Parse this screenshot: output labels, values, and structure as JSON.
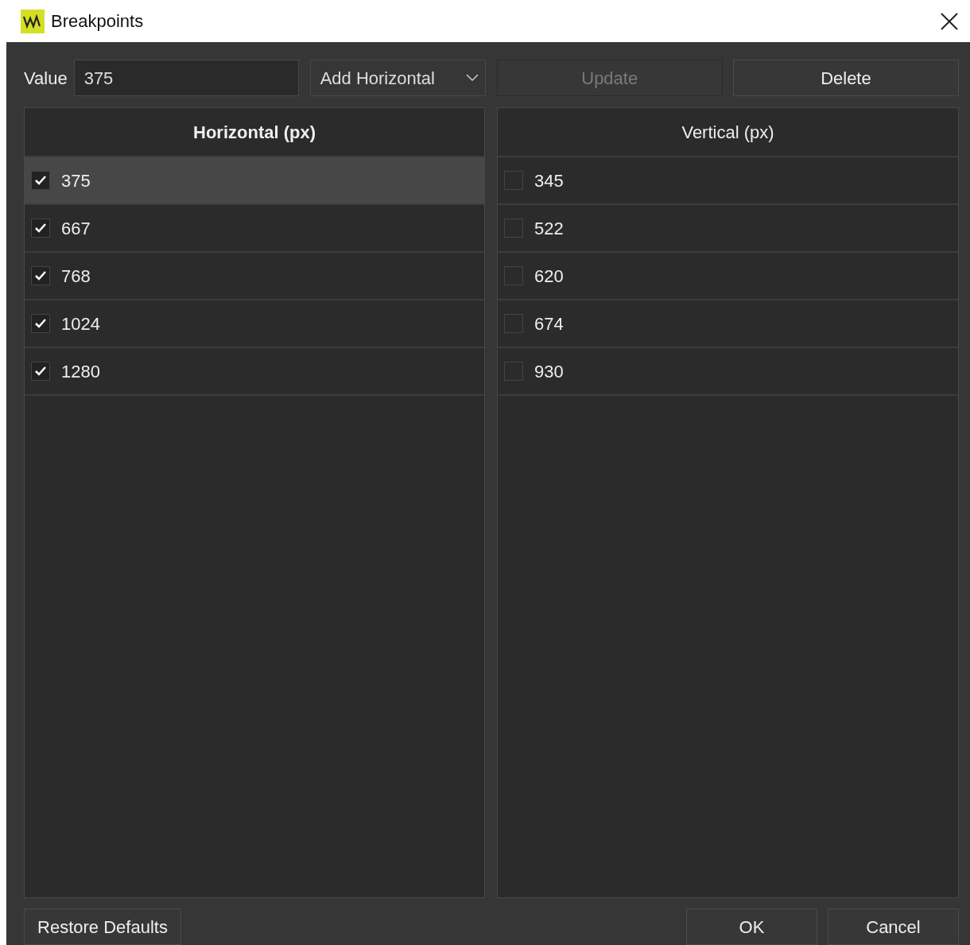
{
  "window": {
    "title": "Breakpoints"
  },
  "toolbar": {
    "value_label": "Value",
    "value": "375",
    "mode": "Add Horizontal",
    "buttons": [
      {
        "label": "Update",
        "disabled": true
      },
      {
        "label": "Delete",
        "disabled": false
      }
    ]
  },
  "lists": [
    {
      "title": "Horizontal (px)",
      "active": true,
      "items": [
        {
          "label": "375",
          "checked": true,
          "selected": true
        },
        {
          "label": "667",
          "checked": true,
          "selected": false
        },
        {
          "label": "768",
          "checked": true,
          "selected": false
        },
        {
          "label": "1024",
          "checked": true,
          "selected": false
        },
        {
          "label": "1280",
          "checked": true,
          "selected": false
        }
      ]
    },
    {
      "title": "Vertical (px)",
      "active": false,
      "items": [
        {
          "label": "345",
          "checked": false,
          "selected": false
        },
        {
          "label": "522",
          "checked": false,
          "selected": false
        },
        {
          "label": "620",
          "checked": false,
          "selected": false
        },
        {
          "label": "674",
          "checked": false,
          "selected": false
        },
        {
          "label": "930",
          "checked": false,
          "selected": false
        }
      ]
    }
  ],
  "footer": {
    "left": "Restore Defaults",
    "right": [
      "OK",
      "Cancel"
    ]
  }
}
